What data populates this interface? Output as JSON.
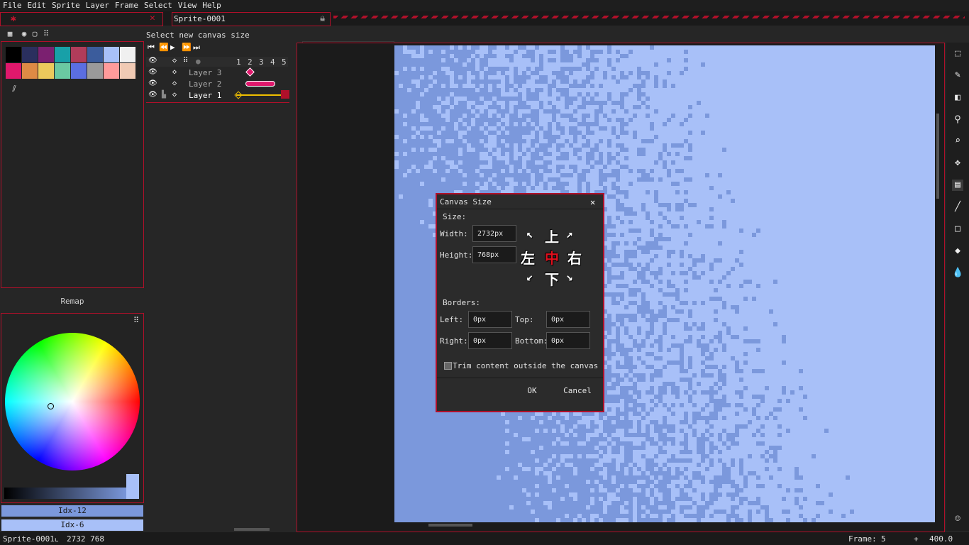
{
  "menu": [
    "File",
    "Edit",
    "Sprite",
    "Layer",
    "Frame",
    "Select",
    "View",
    "Help"
  ],
  "tabs": {
    "active": "Sprite-0001"
  },
  "status_message": "Select new canvas size",
  "palette": {
    "colors": [
      "#000000",
      "#222034",
      "#45283c",
      "#663931",
      "#8f563b",
      "#df7126",
      "#d9a066",
      "#eec39a",
      "#e0186c",
      "#de8a45",
      "#ecc95c",
      "#6ac9a2",
      "#5b6ee1",
      "#9a9a9a",
      "#ff9b9b",
      "#f0cab4"
    ],
    "top_row": [
      "#000000",
      "#2a2f5e",
      "#7b2070",
      "#18a0a8",
      "#b03c5a",
      "#3b5c9c",
      "#a8c0f8",
      "#f0f0f0"
    ],
    "bottom_row": [
      "#e0186c",
      "#de8a45",
      "#ecc95c",
      "#6ac9a2",
      "#5b6ee1",
      "#9a9a9a",
      "#ff9b9b",
      "#f0cab4"
    ]
  },
  "remap_label": "Remap",
  "color_bar": {
    "fg": "Idx-12",
    "bg": "Idx-6",
    "fg_color": "#7b98dc",
    "bg_color": "#a8c0f8"
  },
  "timeline": {
    "frames": [
      "1",
      "2",
      "3",
      "4",
      "5"
    ],
    "layers": [
      "Layer 3",
      "Layer 2",
      "Layer 1"
    ]
  },
  "brushes": [
    "an0073",
    "an0074",
    "an0075",
    "an0076",
    "an0077",
    "an0078",
    "an0079",
    "an0080",
    "an0081",
    "an0082",
    "an0083",
    "an0084",
    "an0085",
    "an0086",
    "an0087",
    "an0088",
    "an0089",
    "an0090",
    "an0091",
    "an0092",
    "an0093"
  ],
  "dialog": {
    "title": "Canvas Size",
    "size_label": "Size:",
    "width_label": "Width:",
    "width_value": "2732px",
    "height_label": "Height:",
    "height_value": "768px",
    "anchor": {
      "top": "上",
      "left": "左",
      "center": "中",
      "right": "右",
      "bottom": "下"
    },
    "borders_label": "Borders:",
    "left_label": "Left:",
    "left_value": "0px",
    "top_label": "Top:",
    "top_value": "0px",
    "right_label": "Right:",
    "right_value": "0px",
    "bottom_label": "Bottom:",
    "bottom_value": "0px",
    "trim_label": "Trim content outside the canvas",
    "ok_label": "OK",
    "cancel_label": "Cancel"
  },
  "status": {
    "sprite_name": "Sprite-0001",
    "size": "2732 768",
    "frame_label": "Frame:",
    "frame_value": "5",
    "plus": "+",
    "zoom": "400.0"
  },
  "accent_color": "#b0102a",
  "canvas_colors": {
    "dark": "#7b98dc",
    "light": "#a8c0f8"
  },
  "icons": [
    "marquee-icon",
    "pencil-icon",
    "eraser-icon",
    "eyedropper-icon",
    "zoom-icon",
    "move-icon",
    "fill-icon",
    "line-icon",
    "rectangle-icon",
    "blur-icon",
    "ink-icon"
  ]
}
